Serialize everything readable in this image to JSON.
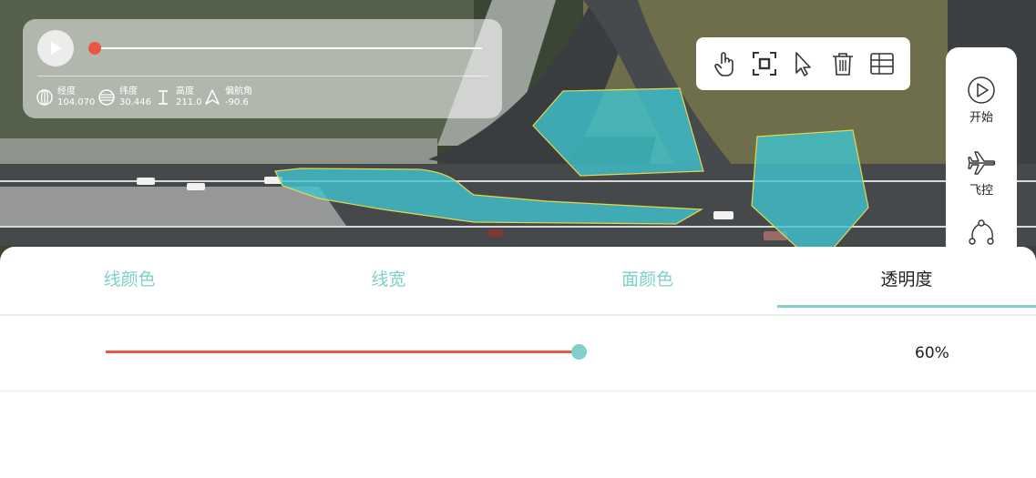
{
  "video": {
    "progress": 0.0,
    "telemetry": [
      {
        "label": "经度",
        "value": "104.070",
        "icon": "globe-icon"
      },
      {
        "label": "纬度",
        "value": "30.446",
        "icon": "latitude-icon"
      },
      {
        "label": "高度",
        "value": "211.0",
        "icon": "altitude-icon"
      },
      {
        "label": "偏航角",
        "value": "-90.6",
        "icon": "heading-icon"
      }
    ]
  },
  "draw_tools": [
    "hand-icon",
    "select-box-icon",
    "cursor-icon",
    "trash-icon",
    "table-icon"
  ],
  "sidebar": {
    "items": [
      {
        "label": "开始",
        "icon": "play-circle-icon"
      },
      {
        "label": "飞控",
        "icon": "airplane-icon"
      },
      {
        "label": "",
        "icon": "route-icon"
      }
    ]
  },
  "style_panel": {
    "tabs": [
      {
        "label": "线颜色",
        "active": false
      },
      {
        "label": "线宽",
        "active": false
      },
      {
        "label": "面颜色",
        "active": false
      },
      {
        "label": "透明度",
        "active": true
      }
    ],
    "opacity_value": "60%",
    "opacity_level": 1.0
  },
  "colors": {
    "accent": "#7fd0c8",
    "slider_fill": "#e85844",
    "polygon_fill": "#3fc4cf",
    "polygon_stroke": "#e6d84a"
  }
}
